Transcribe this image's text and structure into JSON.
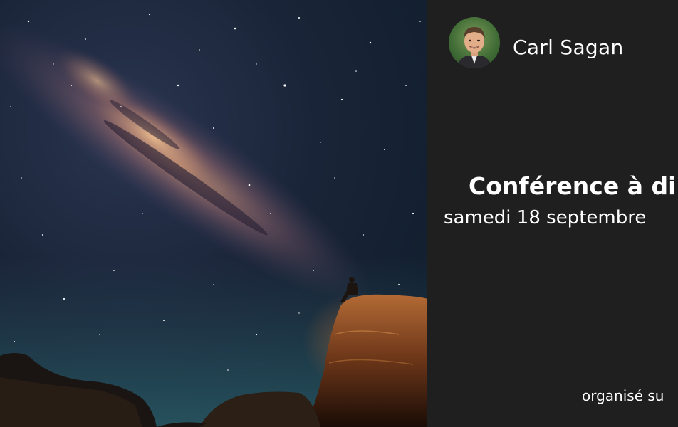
{
  "speaker": {
    "name": "Carl Sagan",
    "avatar_icon": "person-portrait-icon"
  },
  "event": {
    "title": "Conférence à di",
    "date": "samedi 18 septembre"
  },
  "footer": {
    "organizer_text": "organisé su"
  },
  "photo": {
    "subject": "milky-way-night-sky-image"
  },
  "colors": {
    "panel_background": "#1f1f1f",
    "text": "#ffffff"
  }
}
